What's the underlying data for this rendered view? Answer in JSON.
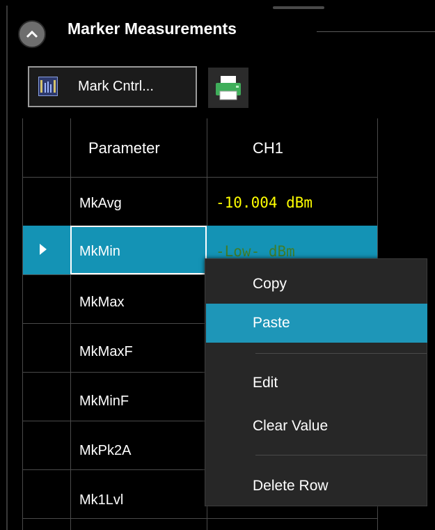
{
  "panel": {
    "title": "Marker Measurements",
    "collapse_icon": "chevron-up-icon"
  },
  "toolbar": {
    "mark_button_label": "Mark Cntrl...",
    "mark_icon": "marker-control-icon",
    "print_icon": "printer-icon"
  },
  "table": {
    "columns": [
      "Parameter",
      "CH1"
    ],
    "rows": [
      {
        "param": "MkAvg",
        "value": "-10.004 dBm",
        "value_color": "#ffff00"
      },
      {
        "param": "MkMin",
        "value": "-Low- dBm",
        "value_color": "#3f7d2a",
        "selected": true
      },
      {
        "param": "MkMax"
      },
      {
        "param": "MkMaxF"
      },
      {
        "param": "MkMinF"
      },
      {
        "param": "MkPk2A"
      },
      {
        "param": "Mk1Lvl"
      }
    ]
  },
  "context_menu": {
    "items": [
      "Copy",
      "Paste",
      "Edit",
      "Clear Value",
      "Delete Row"
    ],
    "highlighted": "Paste"
  },
  "colors": {
    "selection": "#1493b5",
    "menu_highlight": "#1e96b8",
    "value_yellow": "#ffff00"
  }
}
